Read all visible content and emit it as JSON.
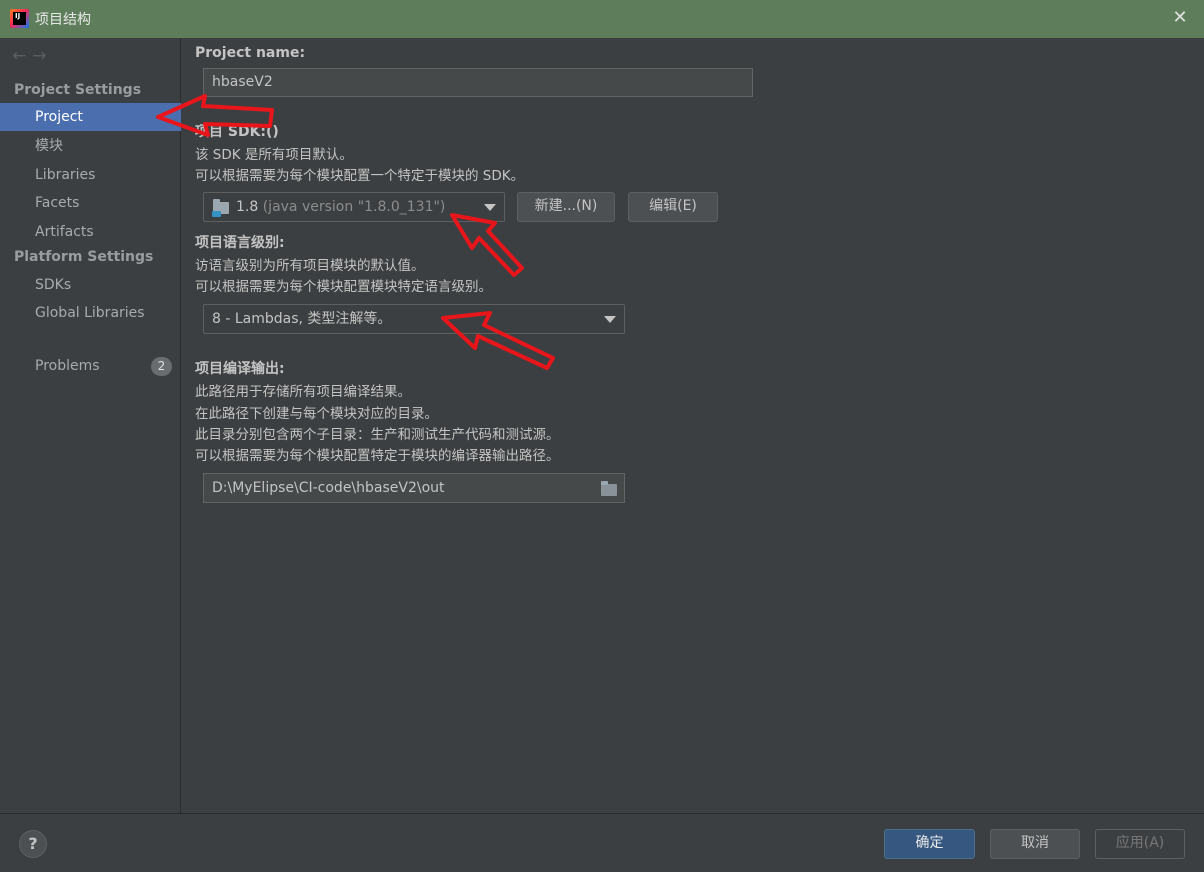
{
  "window": {
    "title": "项目结构",
    "close_icon": "close-icon"
  },
  "nav": {
    "back": "←",
    "forward": "→"
  },
  "sidebar": {
    "project_settings_title": "Project Settings",
    "platform_settings_title": "Platform Settings",
    "items": [
      {
        "label": "Project",
        "selected": true
      },
      {
        "label": "模块"
      },
      {
        "label": "Libraries"
      },
      {
        "label": "Facets"
      },
      {
        "label": "Artifacts"
      },
      {
        "label": "SDKs"
      },
      {
        "label": "Global Libraries"
      },
      {
        "label": "Problems",
        "badge": "2"
      }
    ]
  },
  "main": {
    "project_name_label": "Project name:",
    "project_name_value": "hbaseV2",
    "sdk_label": "项目 SDK:()",
    "sdk_desc1": "该 SDK 是所有项目默认。",
    "sdk_desc2": "可以根据需要为每个模块配置一个特定于模块的 SDK。",
    "sdk_value_version": "1.8",
    "sdk_value_detail": "(java version \"1.8.0_131\")",
    "sdk_new_button": "新建...(N)",
    "sdk_edit_button": "编辑(E)",
    "lang_label": "项目语言级别:",
    "lang_desc1": "访语言级别为所有项目模块的默认值。",
    "lang_desc2": "可以根据需要为每个模块配置模块特定语言级别。",
    "lang_value": "8 - Lambdas, 类型注解等。",
    "output_label": "项目编译输出:",
    "output_desc1": "此路径用于存储所有项目编译结果。",
    "output_desc2": "在此路径下创建与每个模块对应的目录。",
    "output_desc3": "此目录分别包含两个子目录：生产和测试生产代码和测试源。",
    "output_desc4": "可以根据需要为每个模块配置特定于模块的编译器输出路径。",
    "output_value": "D:\\MyElipse\\CI-code\\hbaseV2\\out"
  },
  "footer": {
    "help": "?",
    "ok": "确定",
    "cancel": "取消",
    "apply": "应用(A)"
  },
  "colors": {
    "titlebar": "#5e7e5b",
    "selected": "#4b6eaf",
    "annotation": "#e8161b"
  }
}
